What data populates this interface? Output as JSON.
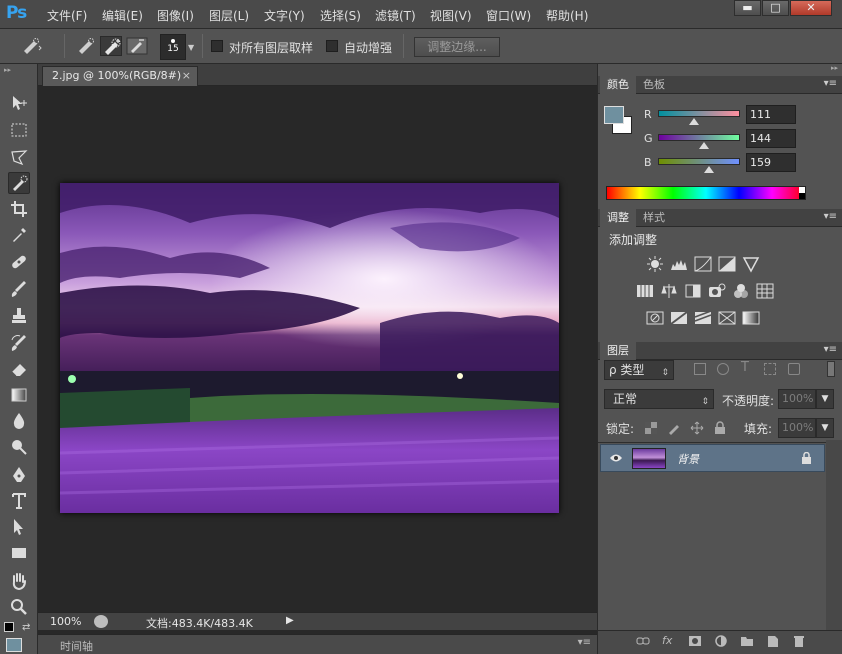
{
  "app": {
    "logo": "Ps"
  },
  "menu": [
    "文件(F)",
    "编辑(E)",
    "图像(I)",
    "图层(L)",
    "文字(Y)",
    "选择(S)",
    "滤镜(T)",
    "视图(V)",
    "窗口(W)",
    "帮助(H)"
  ],
  "window_controls": {
    "minimize": "▬",
    "maximize": "□",
    "close": "✕"
  },
  "options": {
    "brush_size": "15",
    "sample_all_layers": "对所有图层取样",
    "auto_enhance": "自动增强",
    "refine_edge": "调整边缘..."
  },
  "document": {
    "tab_title": "2.jpg @ 100%(RGB/8#)",
    "tab_close": "×",
    "zoom": "100%",
    "doc_info": "文档:483.4K/483.4K",
    "timeline_label": "时间轴"
  },
  "color_panel": {
    "tabs": [
      "颜色",
      "色板"
    ],
    "r_label": "R",
    "g_label": "G",
    "b_label": "B",
    "r_value": "111",
    "g_value": "144",
    "b_value": "159",
    "foreground_color": "#6f909f"
  },
  "adjust_panel": {
    "tabs": [
      "调整",
      "样式"
    ],
    "heading": "添加调整"
  },
  "layers_panel": {
    "tab": "图层",
    "filter_label": "ρ 类型",
    "blend_mode": "正常",
    "opacity_label": "不透明度:",
    "opacity_value": "100%",
    "lock_label": "锁定:",
    "fill_label": "填充:",
    "fill_value": "100%",
    "layer_name": "背景"
  },
  "colors": {
    "accent": "#5e7388",
    "ps_blue": "#36a3f0"
  }
}
